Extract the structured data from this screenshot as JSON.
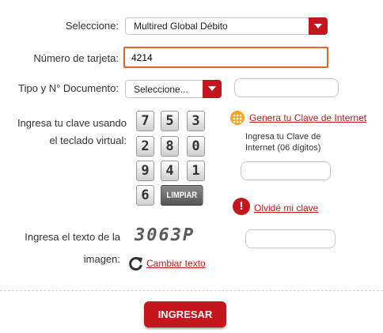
{
  "form": {
    "card_type_label": "Seleccione:",
    "card_type_value": "Multired Global Débito",
    "card_number_label": "Número de tarjeta:",
    "card_number_value": "4214",
    "doc_label": "Tipo y N° Documento:",
    "doc_type_value": "Seleccione...",
    "doc_number_value": "",
    "keypad_label_line1": "Ingresa tu clave usando",
    "keypad_label_line2": "el teclado virtual:",
    "keys": [
      "7",
      "5",
      "3",
      "2",
      "8",
      "0",
      "9",
      "4",
      "1",
      "6"
    ],
    "clear_key": "LIMPIAR",
    "generate_link": "Genera tu Clave de Internet",
    "password_hint_line1": "Ingresa tu Clave de",
    "password_hint_line2": "Internet (06 dígitos)",
    "password_value": "",
    "forgot_link": "Olvidé mi clave",
    "captcha_label_line1": "Ingresa el texto de la",
    "captcha_label_line2": "imagen:",
    "captcha_text": "3063P",
    "change_text_link": "Cambiar texto",
    "captcha_value": "",
    "submit_label": "INGRESAR"
  },
  "colors": {
    "brand_red": "#c4161c",
    "focus_orange": "#e8632a",
    "info_yellow": "#f5a623"
  },
  "icons": {
    "generate": "grid-dots-icon",
    "forgot": "exclamation-icon",
    "refresh": "refresh-icon",
    "dropdown": "caret-down-icon"
  }
}
